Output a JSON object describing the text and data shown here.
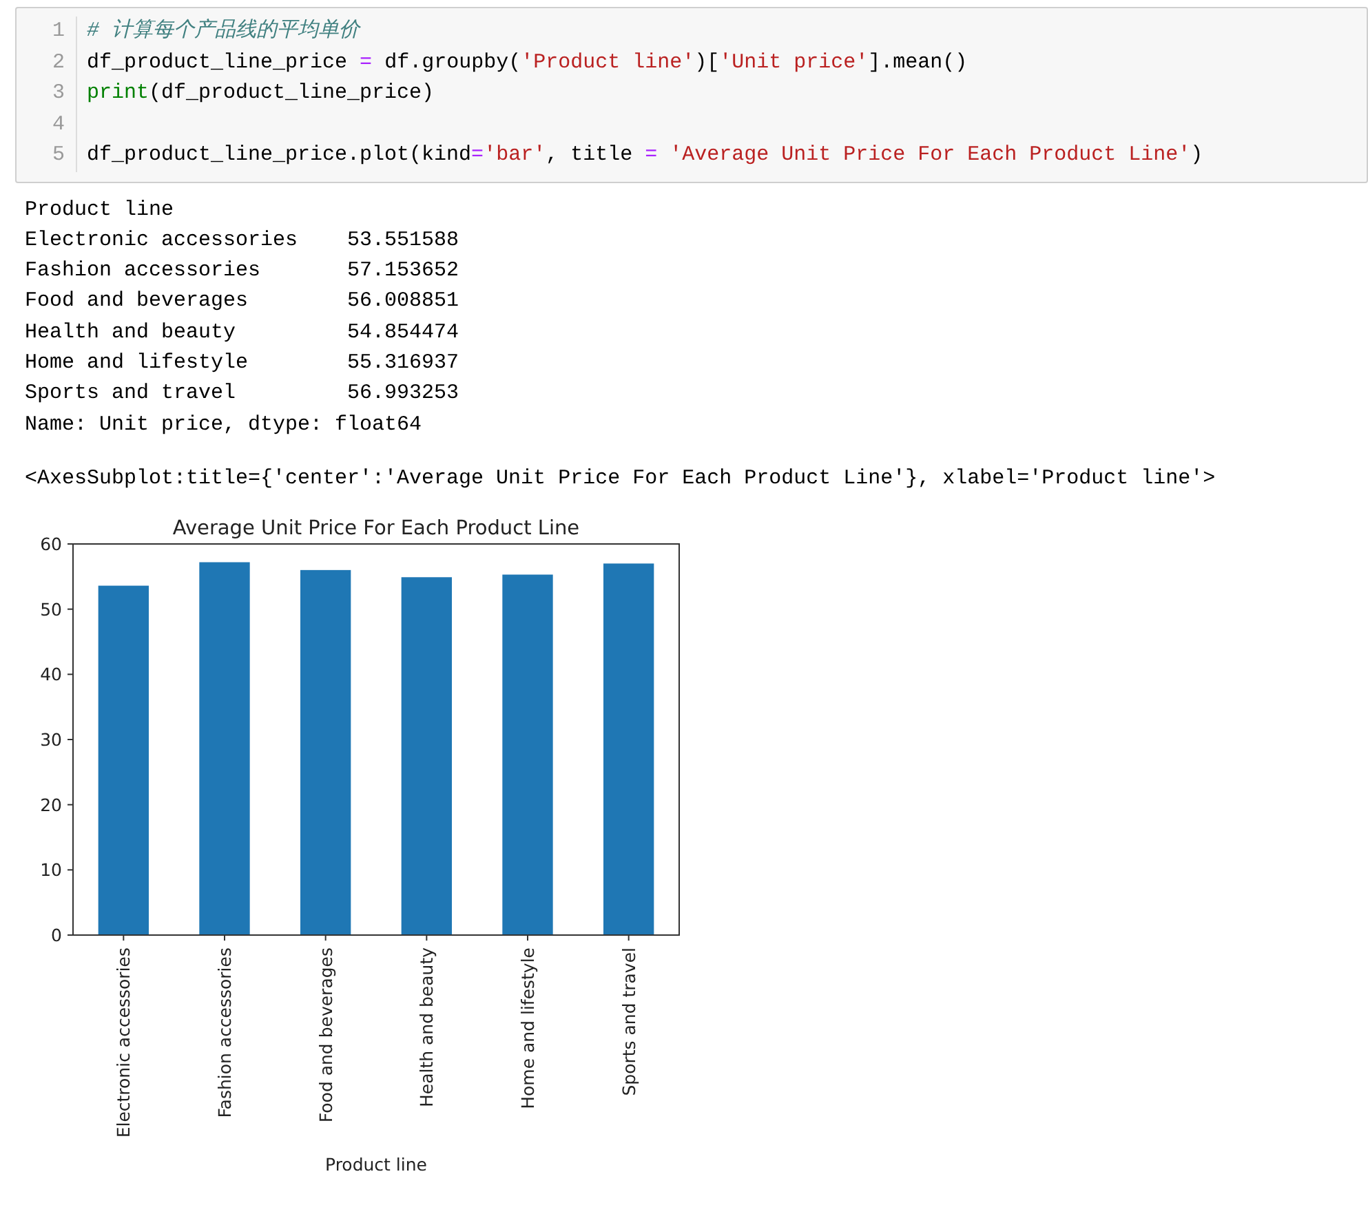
{
  "code_cell": {
    "lines": [
      {
        "number": "1",
        "tokens": [
          {
            "kind": "comment",
            "text": "# 计算每个产品线的平均单价"
          }
        ]
      },
      {
        "number": "2",
        "tokens": [
          {
            "kind": "plain",
            "text": "df_product_line_price "
          },
          {
            "kind": "operator",
            "text": "="
          },
          {
            "kind": "plain",
            "text": " df.groupby("
          },
          {
            "kind": "string",
            "text": "'Product line'"
          },
          {
            "kind": "plain",
            "text": ")["
          },
          {
            "kind": "string",
            "text": "'Unit price'"
          },
          {
            "kind": "plain",
            "text": "].mean()"
          }
        ]
      },
      {
        "number": "3",
        "tokens": [
          {
            "kind": "builtin",
            "text": "print"
          },
          {
            "kind": "plain",
            "text": "(df_product_line_price)"
          }
        ]
      },
      {
        "number": "4"
      },
      {
        "number": "5",
        "tokens": [
          {
            "kind": "plain",
            "text": "df_product_line_price.plot(kind"
          },
          {
            "kind": "operator",
            "text": "="
          },
          {
            "kind": "string",
            "text": "'bar'"
          },
          {
            "kind": "plain",
            "text": ", title "
          },
          {
            "kind": "operator",
            "text": "= "
          },
          {
            "kind": "string",
            "text": "'Average Unit Price For Each Product Line'"
          },
          {
            "kind": "plain",
            "text": ")"
          }
        ]
      }
    ]
  },
  "output": {
    "stdout": [
      "Product line",
      "Electronic accessories    53.551588",
      "Fashion accessories       57.153652",
      "Food and beverages        56.008851",
      "Health and beauty         54.854474",
      "Home and lifestyle        55.316937",
      "Sports and travel         56.993253",
      "Name: Unit price, dtype: float64"
    ],
    "repr": "<AxesSubplot:title={'center':'Average Unit Price For Each Product Line'}, xlabel='Product line'>",
    "chart_data": {
      "type": "bar",
      "title": "Average Unit Price For Each Product Line",
      "xlabel": "Product line",
      "categories": [
        "Electronic accessories",
        "Fashion accessories",
        "Food and beverages",
        "Health and beauty",
        "Home and lifestyle",
        "Sports and travel"
      ],
      "series": [
        {
          "color": "#1f77b4",
          "values": [
            53.6,
            57.2,
            56.0,
            54.9,
            55.3,
            57.0
          ]
        }
      ],
      "ylim": [
        0,
        60
      ],
      "yticks": [
        0,
        10,
        20,
        30,
        40,
        50,
        60
      ]
    }
  }
}
